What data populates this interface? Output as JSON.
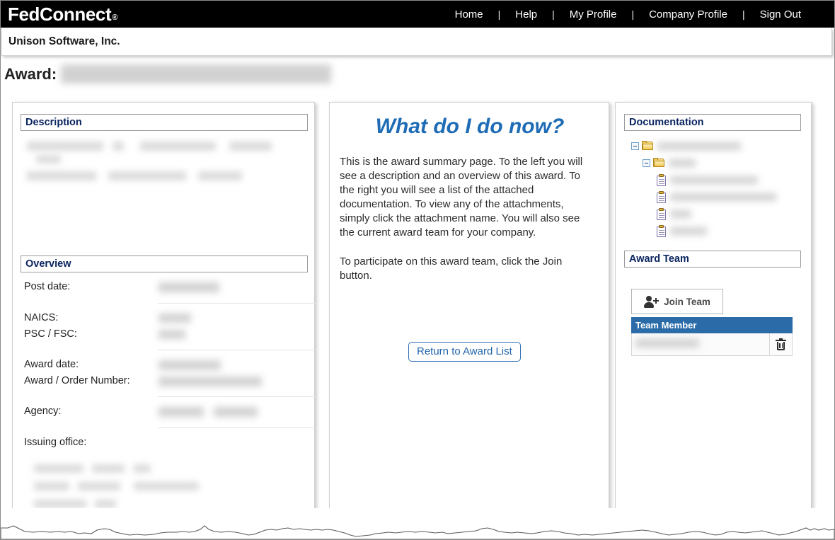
{
  "header": {
    "brand": "FedConnect",
    "brand_mark": "®",
    "nav": [
      {
        "label": "Home"
      },
      {
        "label": "Help"
      },
      {
        "label": "My Profile"
      },
      {
        "label": "Company Profile"
      },
      {
        "label": "Sign Out"
      }
    ],
    "nav_separator": "|",
    "company_name": "Unison Software, Inc."
  },
  "page": {
    "title_label": "Award:",
    "title_value_redacted": true
  },
  "left_column": {
    "description": {
      "heading": "Description",
      "body_redacted": true
    },
    "overview": {
      "heading": "Overview",
      "fields": [
        {
          "label": "Post date:",
          "value_redacted": true
        },
        {
          "label": "NAICS:",
          "value_redacted": true
        },
        {
          "label": "PSC / FSC:",
          "value_redacted": true
        },
        {
          "label": "Award date:",
          "value_redacted": true
        },
        {
          "label": "Award / Order Number:",
          "value_redacted": true
        },
        {
          "label": "Agency:",
          "value_redacted": true
        },
        {
          "label": "Issuing office:",
          "value_redacted": true
        }
      ]
    }
  },
  "middle_column": {
    "title": "What do I do now?",
    "paragraphs": [
      "This is the award summary page. To the left you will see a description and an overview of this award. To the right you will see a list of the attached documentation. To view any of the attachments, simply click the attachment name. You will also see the current award team for your company.",
      "To participate on this award team, click the Join button."
    ],
    "return_button": "Return to Award List"
  },
  "right_column": {
    "documentation": {
      "heading": "Documentation",
      "tree": [
        {
          "type": "folder",
          "depth": 0,
          "expanded": true,
          "label_redacted": true,
          "redact_width": 118
        },
        {
          "type": "folder",
          "depth": 1,
          "expanded": true,
          "label_redacted": true,
          "redact_width": 38
        },
        {
          "type": "document",
          "depth": 2,
          "label_redacted": true,
          "redact_width": 124
        },
        {
          "type": "document",
          "depth": 2,
          "label_redacted": true,
          "redact_width": 150
        },
        {
          "type": "document",
          "depth": 2,
          "label_redacted": true,
          "redact_width": 30
        },
        {
          "type": "document",
          "depth": 2,
          "label_redacted": true,
          "redact_width": 52
        }
      ]
    },
    "award_team": {
      "heading": "Award Team",
      "join_button": "Join Team",
      "join_icon": "person-add-icon",
      "table": {
        "columns": [
          "Team Member",
          ""
        ],
        "rows": [
          {
            "member_redacted": true,
            "action_icon": "trash-icon"
          }
        ]
      },
      "header_color": "#2b6ca8"
    }
  },
  "colors": {
    "topbar": "#000000",
    "heading_text": "#0b2560",
    "accent_blue": "#1f6cb6",
    "link_blue": "#2265ab",
    "table_header": "#2b6ca8"
  }
}
